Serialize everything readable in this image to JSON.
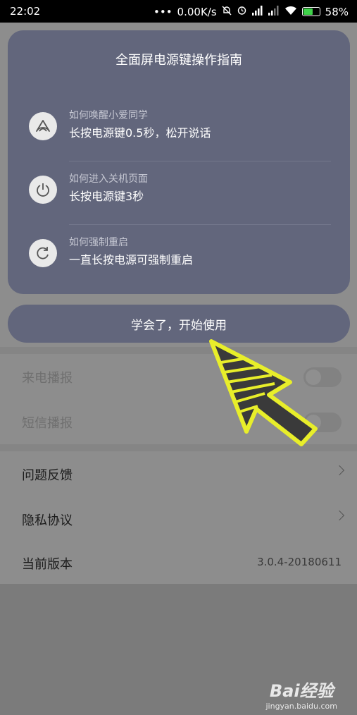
{
  "status_bar": {
    "time": "22:02",
    "speed": "0.00K/s",
    "battery": "58%"
  },
  "background": {
    "rows": {
      "incoming_call": "来电播报",
      "sms": "短信播报",
      "feedback": "问题反馈",
      "privacy": "隐私协议",
      "version_label": "当前版本",
      "version_value": "3.0.4-20180611"
    }
  },
  "dialog": {
    "title": "全面屏电源键操作指南",
    "items": [
      {
        "icon": "xiaoai-icon",
        "question": "如何唤醒小爱同学",
        "answer": "长按电源键0.5秒，松开说话"
      },
      {
        "icon": "power-icon",
        "question": "如何进入关机页面",
        "answer": "长按电源键3秒"
      },
      {
        "icon": "restart-icon",
        "question": "如何强制重启",
        "answer": "一直长按电源可强制重启"
      }
    ],
    "confirm_label": "学会了，开始使用"
  },
  "annotation": {
    "color": "#e8ee2a",
    "icon": "pointer-arrow"
  },
  "watermark": {
    "logo": "Bai经验",
    "site": "jingyan.baidu.com"
  }
}
